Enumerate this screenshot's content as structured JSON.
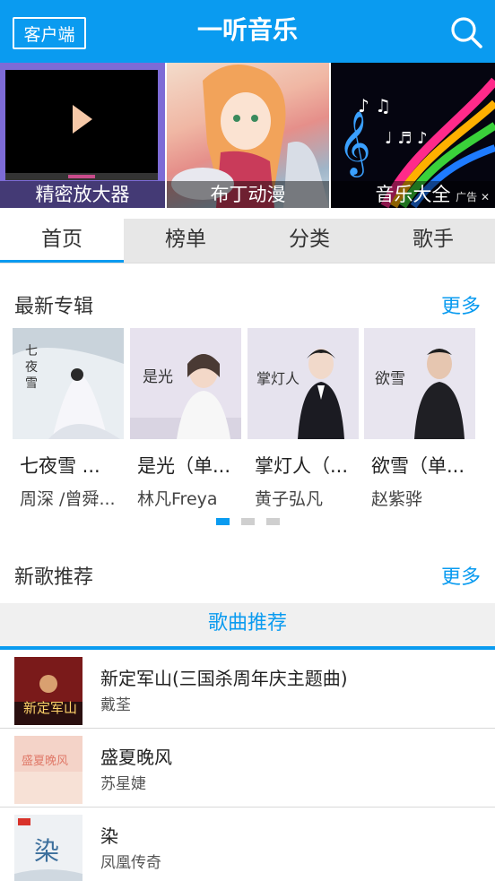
{
  "header": {
    "title": "一听音乐",
    "client_label": "客户端",
    "search_icon": "search-icon",
    "color": "#0a9bf0"
  },
  "banner": [
    {
      "caption": "精密放大器"
    },
    {
      "caption": "布丁动漫"
    },
    {
      "caption": "音乐大全",
      "ad_text": "广告 ✕"
    }
  ],
  "tabs": [
    {
      "label": "首页",
      "active": true
    },
    {
      "label": "榜单",
      "active": false
    },
    {
      "label": "分类",
      "active": false
    },
    {
      "label": "歌手",
      "active": false
    }
  ],
  "latest_albums": {
    "title": "最新专辑",
    "more": "更多",
    "items": [
      {
        "name": "七夜雪 ...",
        "artist": "周深 /曾舜..."
      },
      {
        "name": "是光（单...",
        "artist": "林凡Freya"
      },
      {
        "name": "掌灯人（...",
        "artist": "黄子弘凡"
      },
      {
        "name": "欲雪（单...",
        "artist": "赵紫骅"
      }
    ],
    "pager": {
      "count": 3,
      "active": 0
    }
  },
  "new_songs": {
    "title": "新歌推荐",
    "more": "更多",
    "tab_label": "歌曲推荐",
    "items": [
      {
        "title": "新定军山(三国杀周年庆主题曲)",
        "artist": "戴荃"
      },
      {
        "title": "盛夏晚风",
        "artist": "苏星婕"
      },
      {
        "title": "染",
        "artist": "凤凰传奇"
      }
    ]
  }
}
